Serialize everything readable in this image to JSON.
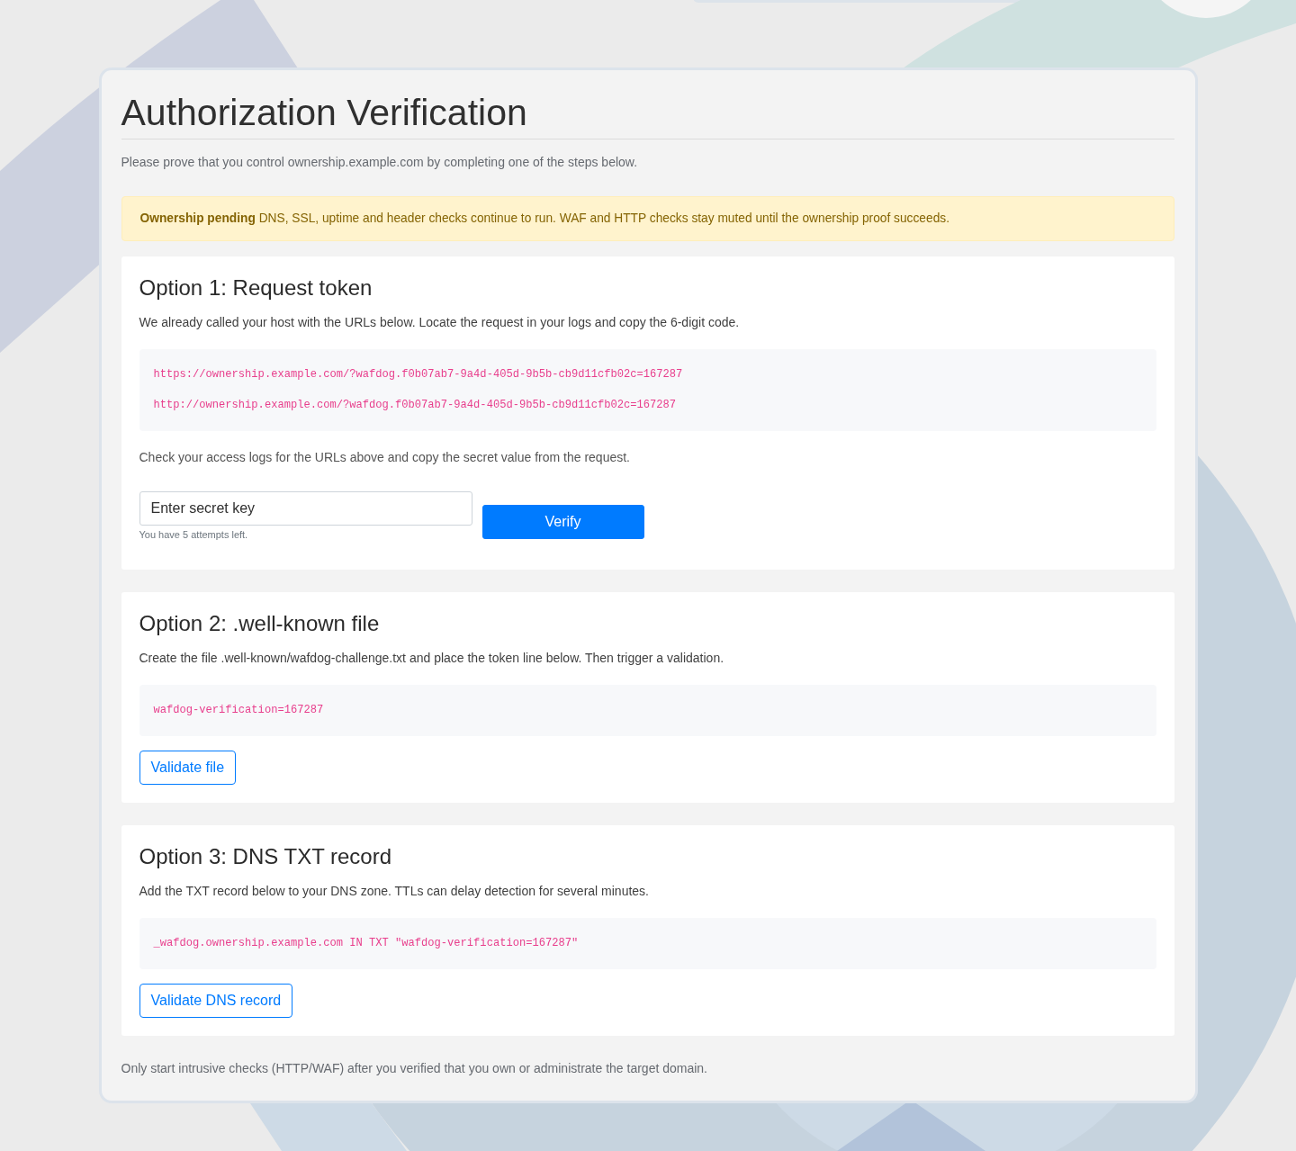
{
  "page": {
    "title": "Authorization Verification",
    "intro": "Please prove that you control ownership.example.com by completing one of the steps below."
  },
  "alert": {
    "text": "**Ownership pending** DNS, SSL, uptime and header checks continue to run. WAF and HTTP checks stay muted until the ownership proof succeeds."
  },
  "options": [
    {
      "kind": "token",
      "title": "Option 1: Request token",
      "description": "We already called your host with the URLs below. Locate the request in your logs and copy the 6-digit code.",
      "code_lines": [
        "https://ownership.example.com/?wafdog.f0b07ab7-9a4d-405d-9b5b-cb9d11cfb02c=167287",
        "http://ownership.example.com/?wafdog.f0b07ab7-9a4d-405d-9b5b-cb9d11cfb02c=167287"
      ],
      "note": "Check your access logs for the URLs above and copy the secret value from the request.",
      "input": {
        "placeholder": "Enter secret key"
      },
      "help": "You have 5 attempts left.",
      "button": "Verify"
    },
    {
      "kind": "file",
      "title": "Option 2: .well-known file",
      "description": "Create the file .well-known/wafdog-challenge.txt and place the token line below. Then trigger a validation.",
      "code_lines": [
        "wafdog-verification=167287"
      ],
      "button": "Validate file"
    },
    {
      "kind": "dns",
      "title": "Option 3: DNS TXT record",
      "description": "Add the TXT record below to your DNS zone. TTLs can delay detection for several minutes.",
      "code_lines": [
        "_wafdog.ownership.example.com IN TXT \"wafdog-verification=167287\""
      ],
      "button": "Validate DNS record"
    }
  ],
  "footer": "Only start intrusive checks (HTTP/WAF) after you verified that you own or administrate the target domain."
}
